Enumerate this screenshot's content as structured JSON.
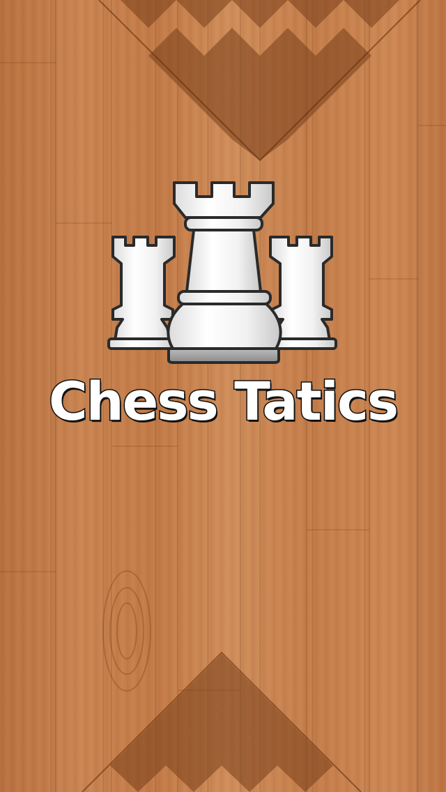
{
  "app": {
    "title": "Chess Tatics"
  },
  "logo": {
    "icon": "rook-pieces-icon"
  },
  "decorations": {
    "top_board_icon": "chessboard-corner-icon",
    "bottom_board_icon": "chessboard-corner-icon"
  },
  "colors": {
    "wood_base": "#c7804d",
    "dark_square": "#8a4f26",
    "title_fill": "#ffffff",
    "title_outline": "#111111"
  }
}
